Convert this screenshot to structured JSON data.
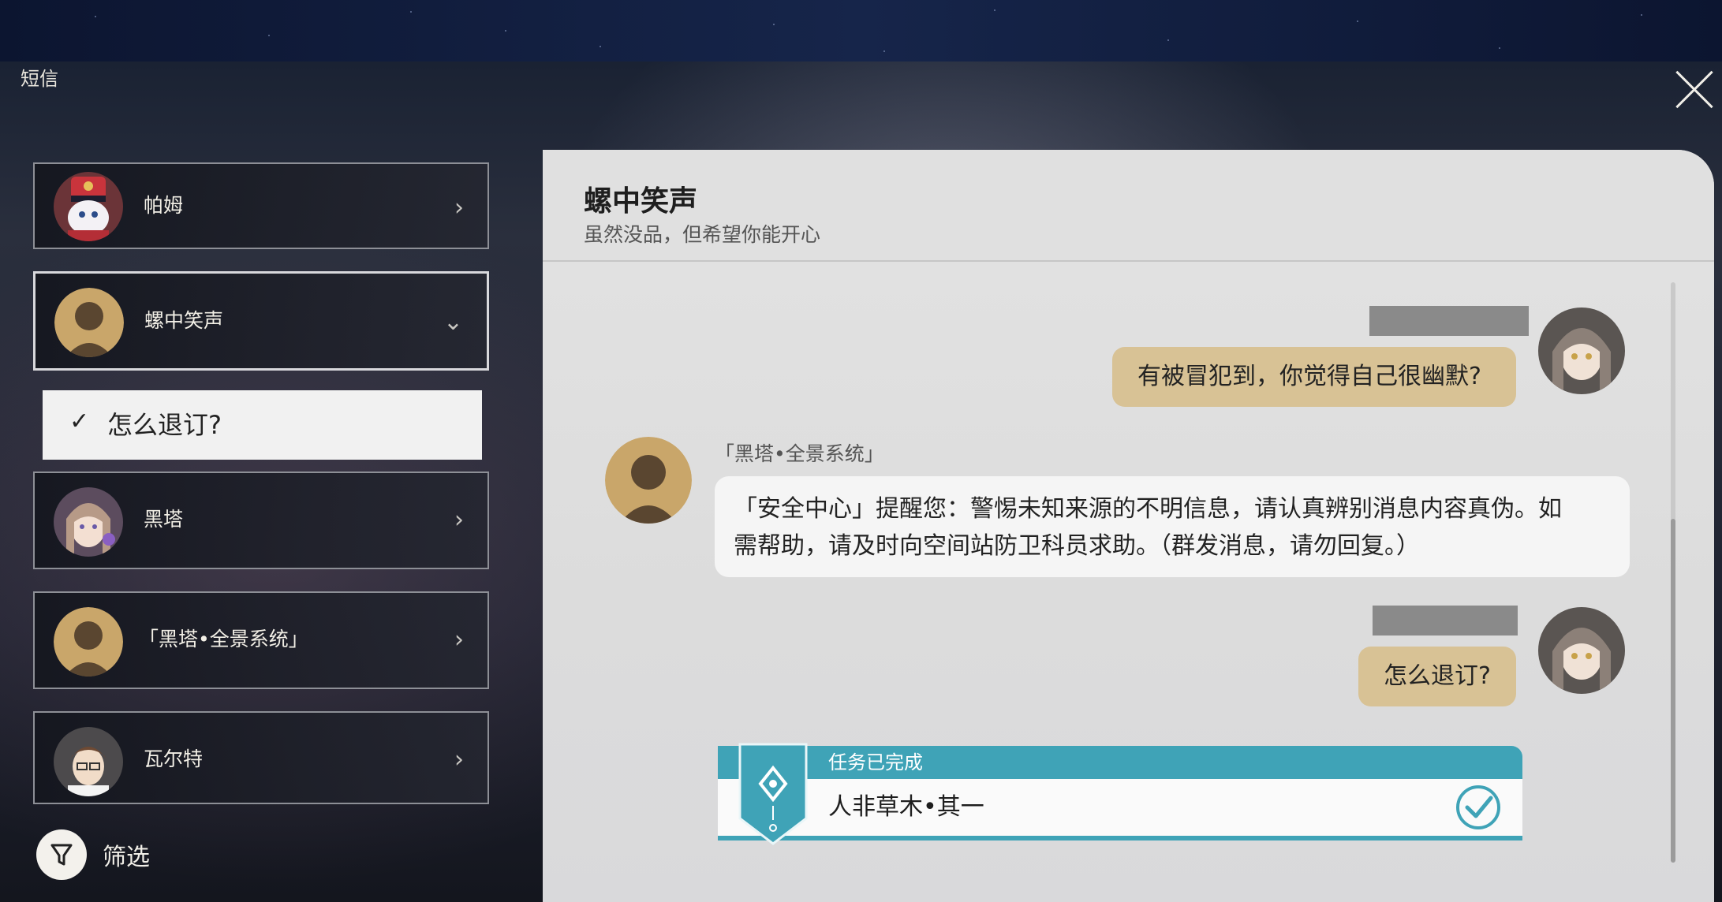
{
  "app": {
    "title": "短信"
  },
  "contacts": [
    {
      "name": "帕姆",
      "avatar": "pom-pom-avatar"
    },
    {
      "name": "螺中笑声",
      "avatar": "silhouette-avatar",
      "expanded": true
    },
    {
      "name": "黑塔",
      "avatar": "herta-avatar"
    },
    {
      "name": "「黑塔•全景系统」",
      "avatar": "silhouette-avatar"
    },
    {
      "name": "瓦尔特",
      "avatar": "welt-avatar"
    }
  ],
  "sub_option": {
    "label": "怎么退订?",
    "checked": true
  },
  "filter": {
    "label": "筛选"
  },
  "chat": {
    "title": "螺中笑声",
    "subtitle": "虽然没品，但希望你能开心",
    "messages": [
      {
        "from": "me",
        "text": "有被冒犯到，你觉得自己很幽默?"
      },
      {
        "from": "them",
        "sender": "「黑塔•全景系统」",
        "text_line1": "「安全中心」提醒您：警惕未知来源的不明信息，请认真辨别消息内容真伪。如",
        "text_line2": "需帮助，请及时向空间站防卫科员求助。（群发消息，请勿回复。）"
      },
      {
        "from": "me",
        "text": "怎么退订?"
      }
    ],
    "task": {
      "status": "任务已完成",
      "name": "人非草木•其一"
    }
  },
  "colors": {
    "bubble_me": "#d8c295",
    "task_accent": "#3fa3b7",
    "panel_bg": "#e0e0e0"
  }
}
